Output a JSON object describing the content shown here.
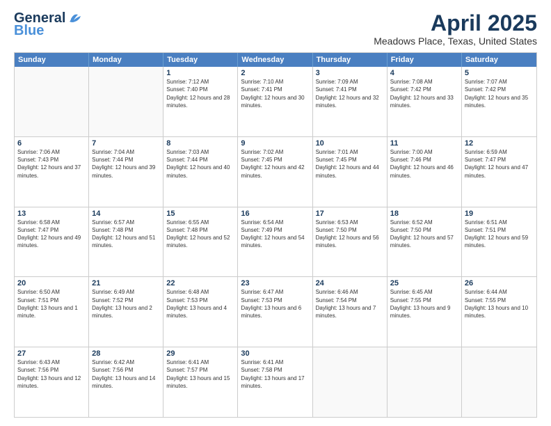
{
  "logo": {
    "line1": "General",
    "line2": "Blue"
  },
  "title": "April 2025",
  "subtitle": "Meadows Place, Texas, United States",
  "days": [
    "Sunday",
    "Monday",
    "Tuesday",
    "Wednesday",
    "Thursday",
    "Friday",
    "Saturday"
  ],
  "weeks": [
    [
      {
        "num": "",
        "info": ""
      },
      {
        "num": "",
        "info": ""
      },
      {
        "num": "1",
        "info": "Sunrise: 7:12 AM\nSunset: 7:40 PM\nDaylight: 12 hours and 28 minutes."
      },
      {
        "num": "2",
        "info": "Sunrise: 7:10 AM\nSunset: 7:41 PM\nDaylight: 12 hours and 30 minutes."
      },
      {
        "num": "3",
        "info": "Sunrise: 7:09 AM\nSunset: 7:41 PM\nDaylight: 12 hours and 32 minutes."
      },
      {
        "num": "4",
        "info": "Sunrise: 7:08 AM\nSunset: 7:42 PM\nDaylight: 12 hours and 33 minutes."
      },
      {
        "num": "5",
        "info": "Sunrise: 7:07 AM\nSunset: 7:42 PM\nDaylight: 12 hours and 35 minutes."
      }
    ],
    [
      {
        "num": "6",
        "info": "Sunrise: 7:06 AM\nSunset: 7:43 PM\nDaylight: 12 hours and 37 minutes."
      },
      {
        "num": "7",
        "info": "Sunrise: 7:04 AM\nSunset: 7:44 PM\nDaylight: 12 hours and 39 minutes."
      },
      {
        "num": "8",
        "info": "Sunrise: 7:03 AM\nSunset: 7:44 PM\nDaylight: 12 hours and 40 minutes."
      },
      {
        "num": "9",
        "info": "Sunrise: 7:02 AM\nSunset: 7:45 PM\nDaylight: 12 hours and 42 minutes."
      },
      {
        "num": "10",
        "info": "Sunrise: 7:01 AM\nSunset: 7:45 PM\nDaylight: 12 hours and 44 minutes."
      },
      {
        "num": "11",
        "info": "Sunrise: 7:00 AM\nSunset: 7:46 PM\nDaylight: 12 hours and 46 minutes."
      },
      {
        "num": "12",
        "info": "Sunrise: 6:59 AM\nSunset: 7:47 PM\nDaylight: 12 hours and 47 minutes."
      }
    ],
    [
      {
        "num": "13",
        "info": "Sunrise: 6:58 AM\nSunset: 7:47 PM\nDaylight: 12 hours and 49 minutes."
      },
      {
        "num": "14",
        "info": "Sunrise: 6:57 AM\nSunset: 7:48 PM\nDaylight: 12 hours and 51 minutes."
      },
      {
        "num": "15",
        "info": "Sunrise: 6:55 AM\nSunset: 7:48 PM\nDaylight: 12 hours and 52 minutes."
      },
      {
        "num": "16",
        "info": "Sunrise: 6:54 AM\nSunset: 7:49 PM\nDaylight: 12 hours and 54 minutes."
      },
      {
        "num": "17",
        "info": "Sunrise: 6:53 AM\nSunset: 7:50 PM\nDaylight: 12 hours and 56 minutes."
      },
      {
        "num": "18",
        "info": "Sunrise: 6:52 AM\nSunset: 7:50 PM\nDaylight: 12 hours and 57 minutes."
      },
      {
        "num": "19",
        "info": "Sunrise: 6:51 AM\nSunset: 7:51 PM\nDaylight: 12 hours and 59 minutes."
      }
    ],
    [
      {
        "num": "20",
        "info": "Sunrise: 6:50 AM\nSunset: 7:51 PM\nDaylight: 13 hours and 1 minute."
      },
      {
        "num": "21",
        "info": "Sunrise: 6:49 AM\nSunset: 7:52 PM\nDaylight: 13 hours and 2 minutes."
      },
      {
        "num": "22",
        "info": "Sunrise: 6:48 AM\nSunset: 7:53 PM\nDaylight: 13 hours and 4 minutes."
      },
      {
        "num": "23",
        "info": "Sunrise: 6:47 AM\nSunset: 7:53 PM\nDaylight: 13 hours and 6 minutes."
      },
      {
        "num": "24",
        "info": "Sunrise: 6:46 AM\nSunset: 7:54 PM\nDaylight: 13 hours and 7 minutes."
      },
      {
        "num": "25",
        "info": "Sunrise: 6:45 AM\nSunset: 7:55 PM\nDaylight: 13 hours and 9 minutes."
      },
      {
        "num": "26",
        "info": "Sunrise: 6:44 AM\nSunset: 7:55 PM\nDaylight: 13 hours and 10 minutes."
      }
    ],
    [
      {
        "num": "27",
        "info": "Sunrise: 6:43 AM\nSunset: 7:56 PM\nDaylight: 13 hours and 12 minutes."
      },
      {
        "num": "28",
        "info": "Sunrise: 6:42 AM\nSunset: 7:56 PM\nDaylight: 13 hours and 14 minutes."
      },
      {
        "num": "29",
        "info": "Sunrise: 6:41 AM\nSunset: 7:57 PM\nDaylight: 13 hours and 15 minutes."
      },
      {
        "num": "30",
        "info": "Sunrise: 6:41 AM\nSunset: 7:58 PM\nDaylight: 13 hours and 17 minutes."
      },
      {
        "num": "",
        "info": ""
      },
      {
        "num": "",
        "info": ""
      },
      {
        "num": "",
        "info": ""
      }
    ]
  ]
}
